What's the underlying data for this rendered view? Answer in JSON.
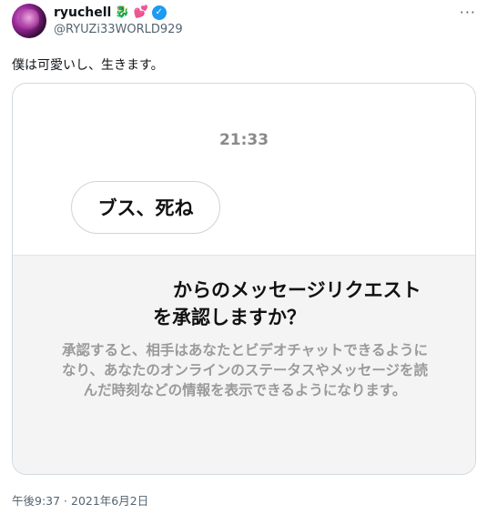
{
  "author": {
    "display_name": "ryuchell",
    "name_emojis": [
      "🐉",
      "💕"
    ],
    "handle": "@RYUZi33WORLD929",
    "avatar_icon": "avatar-image",
    "more_icon": "more-options-icon"
  },
  "tweet": {
    "text": "僕は可愛いし、生きます。",
    "timestamp": "午後9:37 · 2021年6月2日"
  },
  "card": {
    "time": "21:33",
    "message": "ブス、死ね",
    "request_line1": "からのメッセージリクエスト",
    "request_line2": "を承認しますか？",
    "description_lines": [
      "承認すると、相手はあなたとビデオチャットできるように",
      "なり、あなたのオンラインのステータスやメッセージを読",
      "んだ時刻などの情報を表示できるようになります。"
    ]
  },
  "colors": {
    "verified": "#1d9bf0",
    "text_primary": "#0f1419",
    "text_secondary": "#536471"
  }
}
